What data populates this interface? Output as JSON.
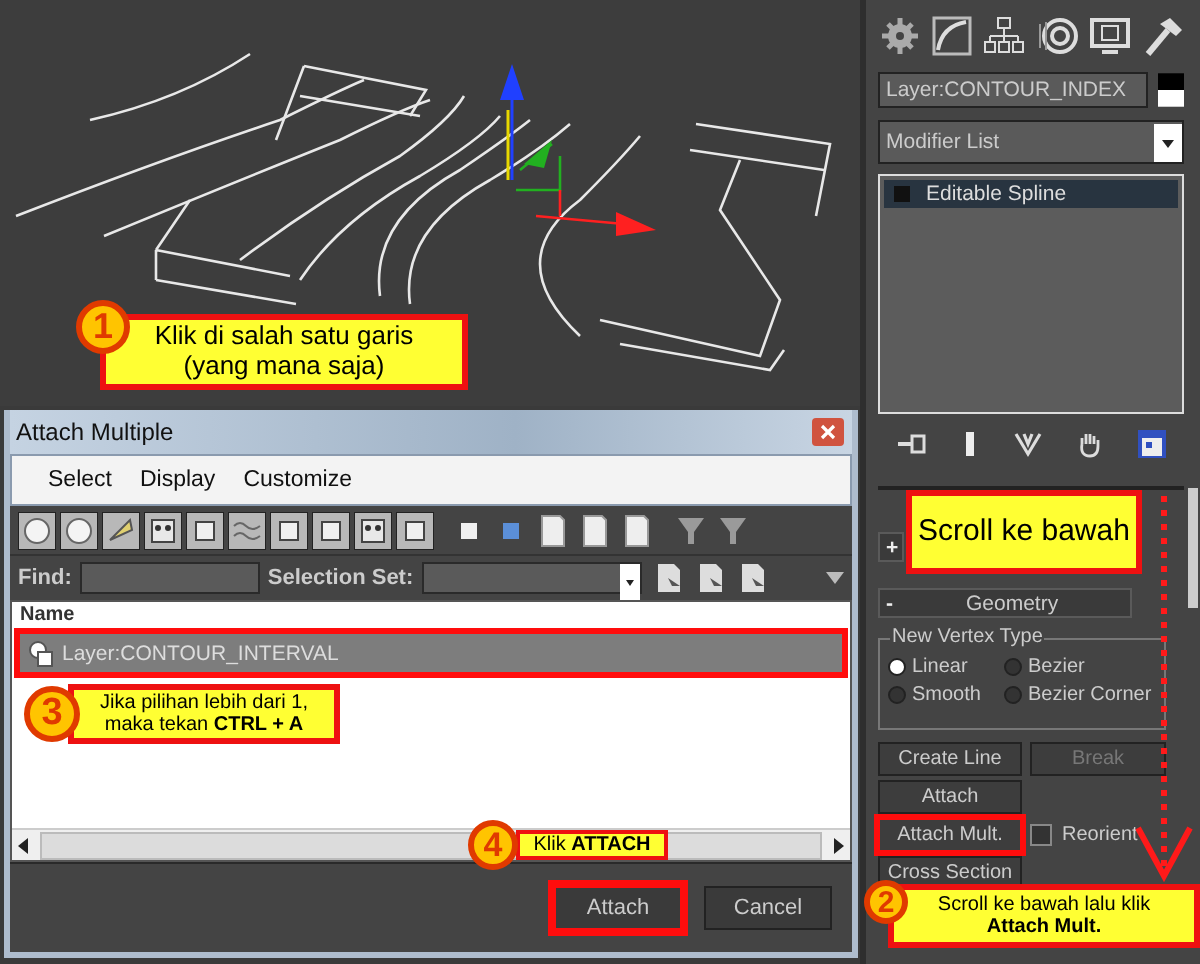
{
  "dialog": {
    "title": "Attach Multiple",
    "menu": [
      "Select",
      "Display",
      "Customize"
    ],
    "find_label": "Find:",
    "selection_set_label": "Selection Set:",
    "column": "Name",
    "rows": [
      {
        "label": "Layer:CONTOUR_INTERVAL",
        "selected": true,
        "highlighted": true
      }
    ],
    "buttons": [
      {
        "label": "Attach",
        "highlighted": true
      },
      {
        "label": "Cancel",
        "highlighted": false
      }
    ]
  },
  "command_panel": {
    "object_name": "Layer:CONTOUR_INDEX",
    "modifier_list": "Modifier List",
    "stack": [
      {
        "label": "Editable Spline",
        "selected": true
      }
    ],
    "rollouts": [
      {
        "sign": "+"
      },
      {
        "sign": "-",
        "title": "Geometry"
      }
    ],
    "vertex_type": {
      "title": "New Vertex Type",
      "options": [
        {
          "label": "Linear",
          "selected": true
        },
        {
          "label": "Bezier",
          "selected": false
        },
        {
          "label": "Smooth",
          "selected": false
        },
        {
          "label": "Bezier Corner",
          "selected": false
        }
      ]
    },
    "buttons": [
      {
        "label": "Create Line",
        "disabled": false,
        "highlighted": false
      },
      {
        "label": "Break",
        "disabled": true,
        "highlighted": false
      },
      {
        "label": "Attach",
        "disabled": false,
        "highlighted": false
      },
      {
        "label": "Attach Mult.",
        "disabled": false,
        "highlighted": true
      },
      {
        "label": "Cross Section",
        "disabled": false,
        "highlighted": false
      }
    ],
    "reorient": {
      "label": "Reorient",
      "checked": false
    }
  },
  "annotations": [
    {
      "number": "1",
      "lines": [
        "Klik di salah satu garis",
        "(yang mana saja)"
      ]
    },
    {
      "number": "3",
      "lines": [
        "Jika pilihan lebih dari 1,",
        "maka tekan **CTRL + A**"
      ]
    },
    {
      "number": "4",
      "lines": [
        "Klik **ATTACH**"
      ]
    },
    {
      "lines": [
        "Scroll ke bawah"
      ]
    },
    {
      "number": "2",
      "lines": [
        "Scroll ke bawah lalu klik",
        "**Attach Mult.**"
      ]
    }
  ]
}
